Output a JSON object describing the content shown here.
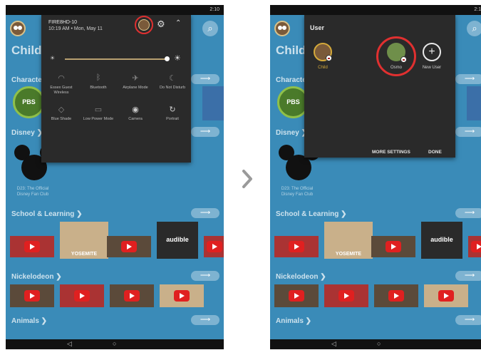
{
  "status_bar": {
    "right_text_left": "",
    "right_text_right": "2:10"
  },
  "quick_settings": {
    "device_name": "FIRE8HD-10",
    "datetime": "10:19 AM • Mon, May 11",
    "brightness_level": 1.0,
    "tiles": [
      {
        "icon": "wifi-icon",
        "label": "Essex Guest Wireless"
      },
      {
        "icon": "bluetooth-icon",
        "label": "Bluetooth"
      },
      {
        "icon": "airplane-icon",
        "label": "Airplane Mode"
      },
      {
        "icon": "moon-icon",
        "label": "Do Not Disturb"
      },
      {
        "icon": "blue-shade-icon",
        "label": "Blue Shade"
      },
      {
        "icon": "battery-icon",
        "label": "Low Power Mode"
      },
      {
        "icon": "camera-icon",
        "label": "Camera"
      },
      {
        "icon": "rotate-icon",
        "label": "Portrait"
      }
    ]
  },
  "user_panel": {
    "title": "User",
    "users": [
      {
        "name": "Child",
        "name_color": "#d4a93a",
        "avatar": "owl-avatar"
      },
      {
        "name": "Osmo",
        "name_color": "#cfcfcf",
        "avatar": "osmo-avatar"
      },
      {
        "name": "New User",
        "name_color": "#cfcfcf",
        "avatar": "plus-icon"
      }
    ],
    "more_settings": "MORE SETTINGS",
    "done": "DONE"
  },
  "kids_app": {
    "profile_title": "Child",
    "sections": {
      "characters": "Characte",
      "disney": "Disney ❯",
      "school": "School & Learning ❯",
      "nickelodeon": "Nickelodeon ❯",
      "animals": "Animals ❯"
    },
    "pbs_label": "PBS",
    "disney_caption": "D23: The Official Disney Fan Club",
    "yosemite_label": "YOSEMITE",
    "audible_label": "audible"
  },
  "colors": {
    "highlight": "#e03030",
    "app_background": "#3a8bb8",
    "panel_background": "#2a2a2a"
  }
}
